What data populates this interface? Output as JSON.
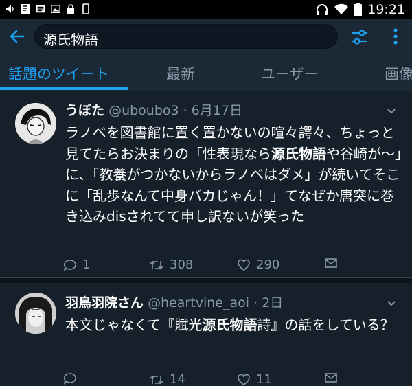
{
  "status_bar": {
    "time": "19:21",
    "left_icons": [
      "volume-icon",
      "document-icon",
      "news-icon",
      "image-icon",
      "lock-icon",
      "phone-icon"
    ],
    "right_icons": [
      "headset-icon",
      "wifi-icon",
      "battery-icon"
    ]
  },
  "search": {
    "query": "源氏物語"
  },
  "tabs": [
    {
      "label": "話題のツイート",
      "active": true
    },
    {
      "label": "最新",
      "active": false
    },
    {
      "label": "ユーザー",
      "active": false
    },
    {
      "label": "画像",
      "active": false
    }
  ],
  "tweets": [
    {
      "name": "うぼた",
      "handle": "@uboubo3",
      "time": "6月17日",
      "text_segments": [
        {
          "t": "ラノベを図書館に置く置かないの喧々諤々、ちょっと見てたらお決まりの「性表現なら",
          "bold": false
        },
        {
          "t": "源氏物語",
          "bold": true
        },
        {
          "t": "や谷崎が〜」に、「教養がつかないからラノベはダメ」が続いてそこに「乱歩なんて中身バカじゃん！」てなぜか唐突に巻き込みdisされてて申し訳ないが笑った",
          "bold": false
        }
      ],
      "replies": "1",
      "retweets": "308",
      "likes": "290"
    },
    {
      "name": "羽鳥羽院さん",
      "handle": "@heartvine_aoi",
      "time": "2日",
      "text_segments": [
        {
          "t": "本文じゃなくて『賦光",
          "bold": false
        },
        {
          "t": "源氏物語",
          "bold": true
        },
        {
          "t": "詩』の話をしている？",
          "bold": false
        }
      ],
      "replies": "",
      "retweets": "14",
      "likes": "11"
    }
  ],
  "colors": {
    "accent": "#1da1f2",
    "bar_bg": "#1b2836",
    "feed_bg": "#15202b",
    "muted": "#8899a6"
  }
}
